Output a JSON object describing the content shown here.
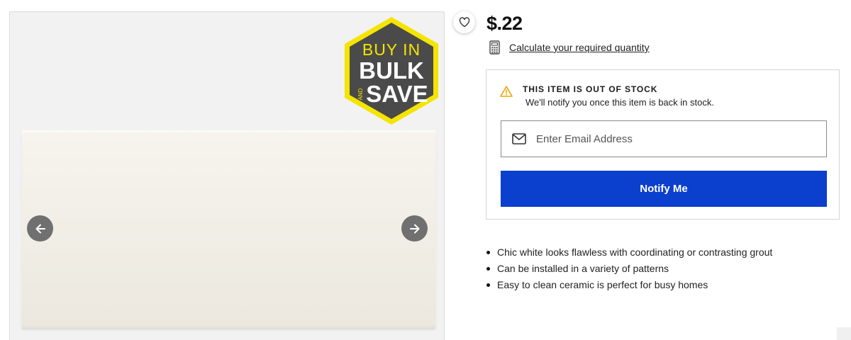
{
  "badge": {
    "line1": "BUY IN",
    "line2": "BULK",
    "line3_small": "AND",
    "line3": "SAVE",
    "colors": {
      "hex": "#4a4a4a",
      "border": "#f4e400",
      "text": "#ffffff",
      "accent": "#f4e400"
    }
  },
  "price": "$.22",
  "calculator": {
    "icon": "calculator-icon",
    "link_text": "Calculate your required quantity"
  },
  "stock": {
    "icon": "warning-icon",
    "title": "THIS ITEM IS OUT OF STOCK",
    "message": "We'll notify you once this item is back in stock.",
    "email_placeholder": "Enter Email Address",
    "email_value": "",
    "email_icon": "envelope-icon",
    "button_label": "Notify Me",
    "button_color": "#0b3fce"
  },
  "features": [
    "Chic white looks flawless with coordinating or contrasting grout",
    "Can be installed in a variety of patterns",
    "Easy to clean ceramic is perfect for busy homes"
  ],
  "icons": {
    "prev": "arrow-left-icon",
    "next": "arrow-right-icon",
    "favorite": "heart-icon"
  }
}
